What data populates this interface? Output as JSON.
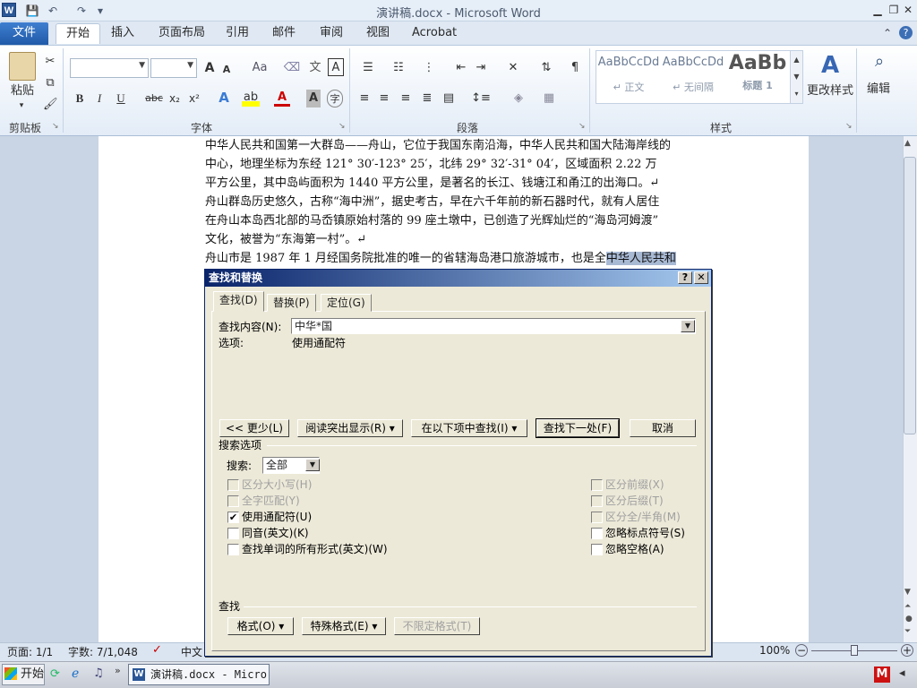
{
  "window": {
    "title": "演讲稿.docx - Microsoft Word",
    "word_icon": "W",
    "qat": {
      "save_icon": "💾",
      "undo_icon": "↶",
      "redo_icon": "↷",
      "customize_icon": "▾"
    },
    "controls": {
      "minimize": "▭",
      "restore": "▭",
      "close": "✕",
      "help": "?",
      "ribbon_min": "⌃"
    }
  },
  "ribbon": {
    "file_tab": "文件",
    "tabs": [
      "开始",
      "插入",
      "页面布局",
      "引用",
      "邮件",
      "审阅",
      "视图",
      "Acrobat"
    ],
    "groups": {
      "clipboard": {
        "label": "剪贴板",
        "paste": "粘贴"
      },
      "font": {
        "label": "字体",
        "font_name": "",
        "font_size": "",
        "grow": "A",
        "shrink": "A",
        "clear": "Aa",
        "bold": "B",
        "italic": "I",
        "underline": "U",
        "strike": "abc",
        "sub": "x₂",
        "sup": "x²"
      },
      "paragraph": {
        "label": "段落"
      },
      "styles": {
        "label": "样式",
        "items": [
          {
            "sample": "AaBbCcDd",
            "name": "↵ 正文"
          },
          {
            "sample": "AaBbCcDd",
            "name": "↵ 无间隔"
          },
          {
            "sample": "AaBb",
            "name": "标题 1"
          }
        ],
        "change_styles": "更改样式"
      },
      "editing": {
        "label": "编辑"
      }
    }
  },
  "document": {
    "lines": [
      {
        "text": "中华人民共和国第一大群岛——舟山，它位于我国东南沿海，中华人民共和国大陆海岸线的"
      },
      {
        "text": "中心，地理坐标为东经 121° 30′-123° 25′，北纬 29° 32′-31° 04′，区域面积 2.22 万"
      },
      {
        "text": "平方公里，其中岛屿面积为 1440 平方公里，是著名的长江、钱塘江和甬江的出海口。↵"
      },
      {
        "text": "舟山群岛历史悠久，古称“海中洲”，据史考古，早在六千年前的新石器时代，就有人居住"
      },
      {
        "text": "在舟山本岛西北部的马岙镇原始村落的 99 座土墩中，已创造了光辉灿烂的“海岛河姆渡”"
      },
      {
        "text": "文化，被誉为“东海第一村”。↵"
      },
      {
        "text": "舟山市是 1987 年 1 月经国务院批准的唯一的省辖海岛港口旅游城市，也是全",
        "highlight": "中华人民共和"
      }
    ]
  },
  "dialog": {
    "title": "查找和替换",
    "help": "?",
    "close": "✕",
    "tabs": {
      "find": "查找(D)",
      "replace": "替换(P)",
      "goto": "定位(G)"
    },
    "find_label": "查找内容(N):",
    "find_value": "中华*国",
    "options_label": "选项:",
    "options_value": "使用通配符",
    "buttons": {
      "less": "<< 更少(L)",
      "reading_highlight": "阅读突出显示(R) ▾",
      "find_in": "在以下项中查找(I) ▾",
      "find_next": "查找下一处(F)",
      "cancel": "取消"
    },
    "search_options_label": "搜索选项",
    "search_label": "搜索:",
    "search_value": "全部",
    "checks_left": [
      {
        "label": "区分大小写(H)",
        "checked": false,
        "enabled": false
      },
      {
        "label": "全字匹配(Y)",
        "checked": false,
        "enabled": false
      },
      {
        "label": "使用通配符(U)",
        "checked": true,
        "enabled": true
      },
      {
        "label": "同音(英文)(K)",
        "checked": false,
        "enabled": true
      },
      {
        "label": "查找单词的所有形式(英文)(W)",
        "checked": false,
        "enabled": true
      }
    ],
    "checks_right": [
      {
        "label": "区分前缀(X)",
        "checked": false,
        "enabled": false
      },
      {
        "label": "区分后缀(T)",
        "checked": false,
        "enabled": false
      },
      {
        "label": "区分全/半角(M)",
        "checked": false,
        "enabled": false
      },
      {
        "label": "忽略标点符号(S)",
        "checked": false,
        "enabled": true
      },
      {
        "label": "忽略空格(A)",
        "checked": false,
        "enabled": true
      }
    ],
    "find_section_label": "查找",
    "bottom_buttons": {
      "format": "格式(O) ▾",
      "special": "特殊格式(E) ▾",
      "no_format": "不限定格式(T)"
    }
  },
  "status": {
    "page": "页面: 1/1",
    "words": "字数: 7/1,048",
    "lang": "中文",
    "zoom": "100%"
  },
  "taskbar": {
    "start": "开始",
    "task_item": "演讲稿.docx - Micro..."
  }
}
